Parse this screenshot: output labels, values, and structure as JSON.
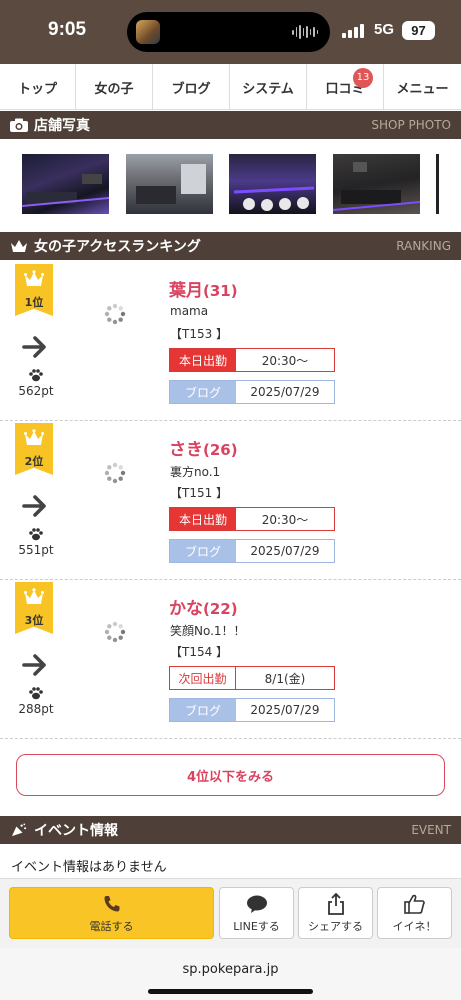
{
  "status": {
    "time": "9:05",
    "network": "5G",
    "battery": "97"
  },
  "nav": {
    "items": [
      {
        "label": "トップ"
      },
      {
        "label": "女の子"
      },
      {
        "label": "ブログ"
      },
      {
        "label": "システム"
      },
      {
        "label": "口コミ",
        "badge": "13"
      },
      {
        "label": "メニュー"
      }
    ]
  },
  "shop_photo": {
    "title": "店舗写真",
    "en": "SHOP PHOTO"
  },
  "ranking": {
    "title": "女の子アクセスランキング",
    "en": "RANKING",
    "items": [
      {
        "rank": "1位",
        "points": "562pt",
        "name": "葉月",
        "age": "(31)",
        "catch": "mama",
        "size": "【T153 】",
        "shift_label": "本日出勤",
        "shift_value": "20:30〜",
        "shift_type": "today",
        "blog_label": "ブログ",
        "blog_date": "2025/07/29"
      },
      {
        "rank": "2位",
        "points": "551pt",
        "name": "さき",
        "age": "(26)",
        "catch": "裏方no.1",
        "size": "【T151 】",
        "shift_label": "本日出勤",
        "shift_value": "20:30〜",
        "shift_type": "today",
        "blog_label": "ブログ",
        "blog_date": "2025/07/29"
      },
      {
        "rank": "3位",
        "points": "288pt",
        "name": "かな",
        "age": "(22)",
        "catch": "笑顔No.1！！",
        "size": "【T154 】",
        "shift_label": "次回出勤",
        "shift_value": "8/1(金)",
        "shift_type": "next",
        "blog_label": "ブログ",
        "blog_date": "2025/07/29"
      }
    ],
    "more_label": "4位以下をみる"
  },
  "event": {
    "title": "イベント情報",
    "en": "EVENT",
    "empty_text": "イベント情報はありません"
  },
  "actions": {
    "call": "電話する",
    "line": "LINEする",
    "share": "シェアする",
    "like": "イイネ！"
  },
  "browser": {
    "url": "sp.pokepara.jp"
  },
  "colors": {
    "header_brown": "#4e4038",
    "status_brown": "#5a4a3f",
    "accent_pink": "#d9435f",
    "gold": "#f7c325",
    "red": "#e53535"
  }
}
